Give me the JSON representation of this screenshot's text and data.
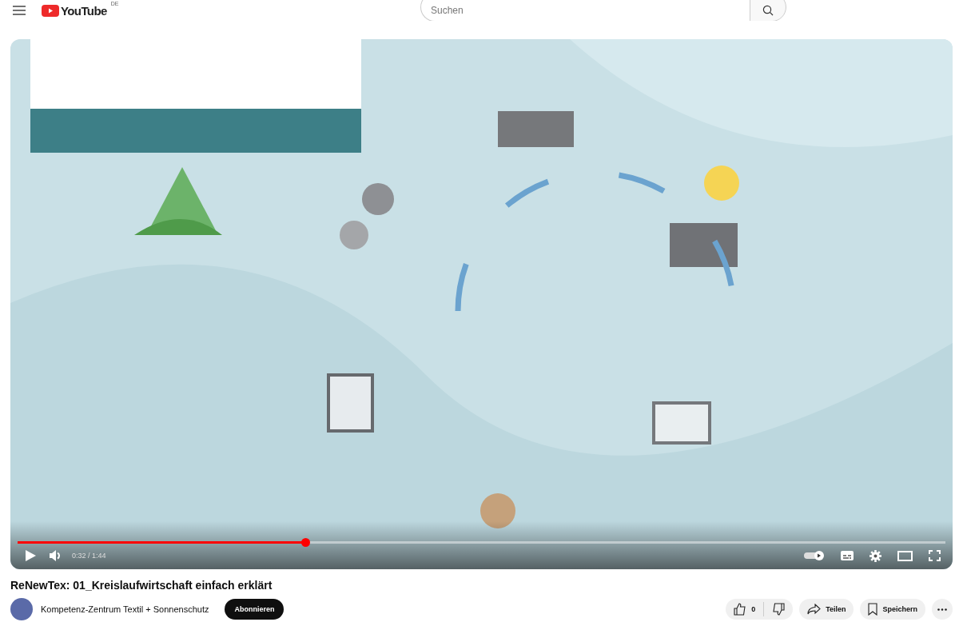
{
  "header": {
    "logo": "YouTube",
    "region": "DE",
    "search": {
      "placeholder": "Suchen"
    }
  },
  "player": {
    "kind": "picture",
    "progress": {
      "level": 0.31
    },
    "time": "0:32 / 1:44",
    "autoplay_on": true
  },
  "video": {
    "title": "ReNewTex: 01_Kreislaufwirtschaft einfach erklärt",
    "channel": "Kompetenz-Zentrum Textil + Sonnenschutz",
    "subscribe": "Abonnieren",
    "likes": "0",
    "share": "Teilen",
    "save": "Speichern"
  }
}
